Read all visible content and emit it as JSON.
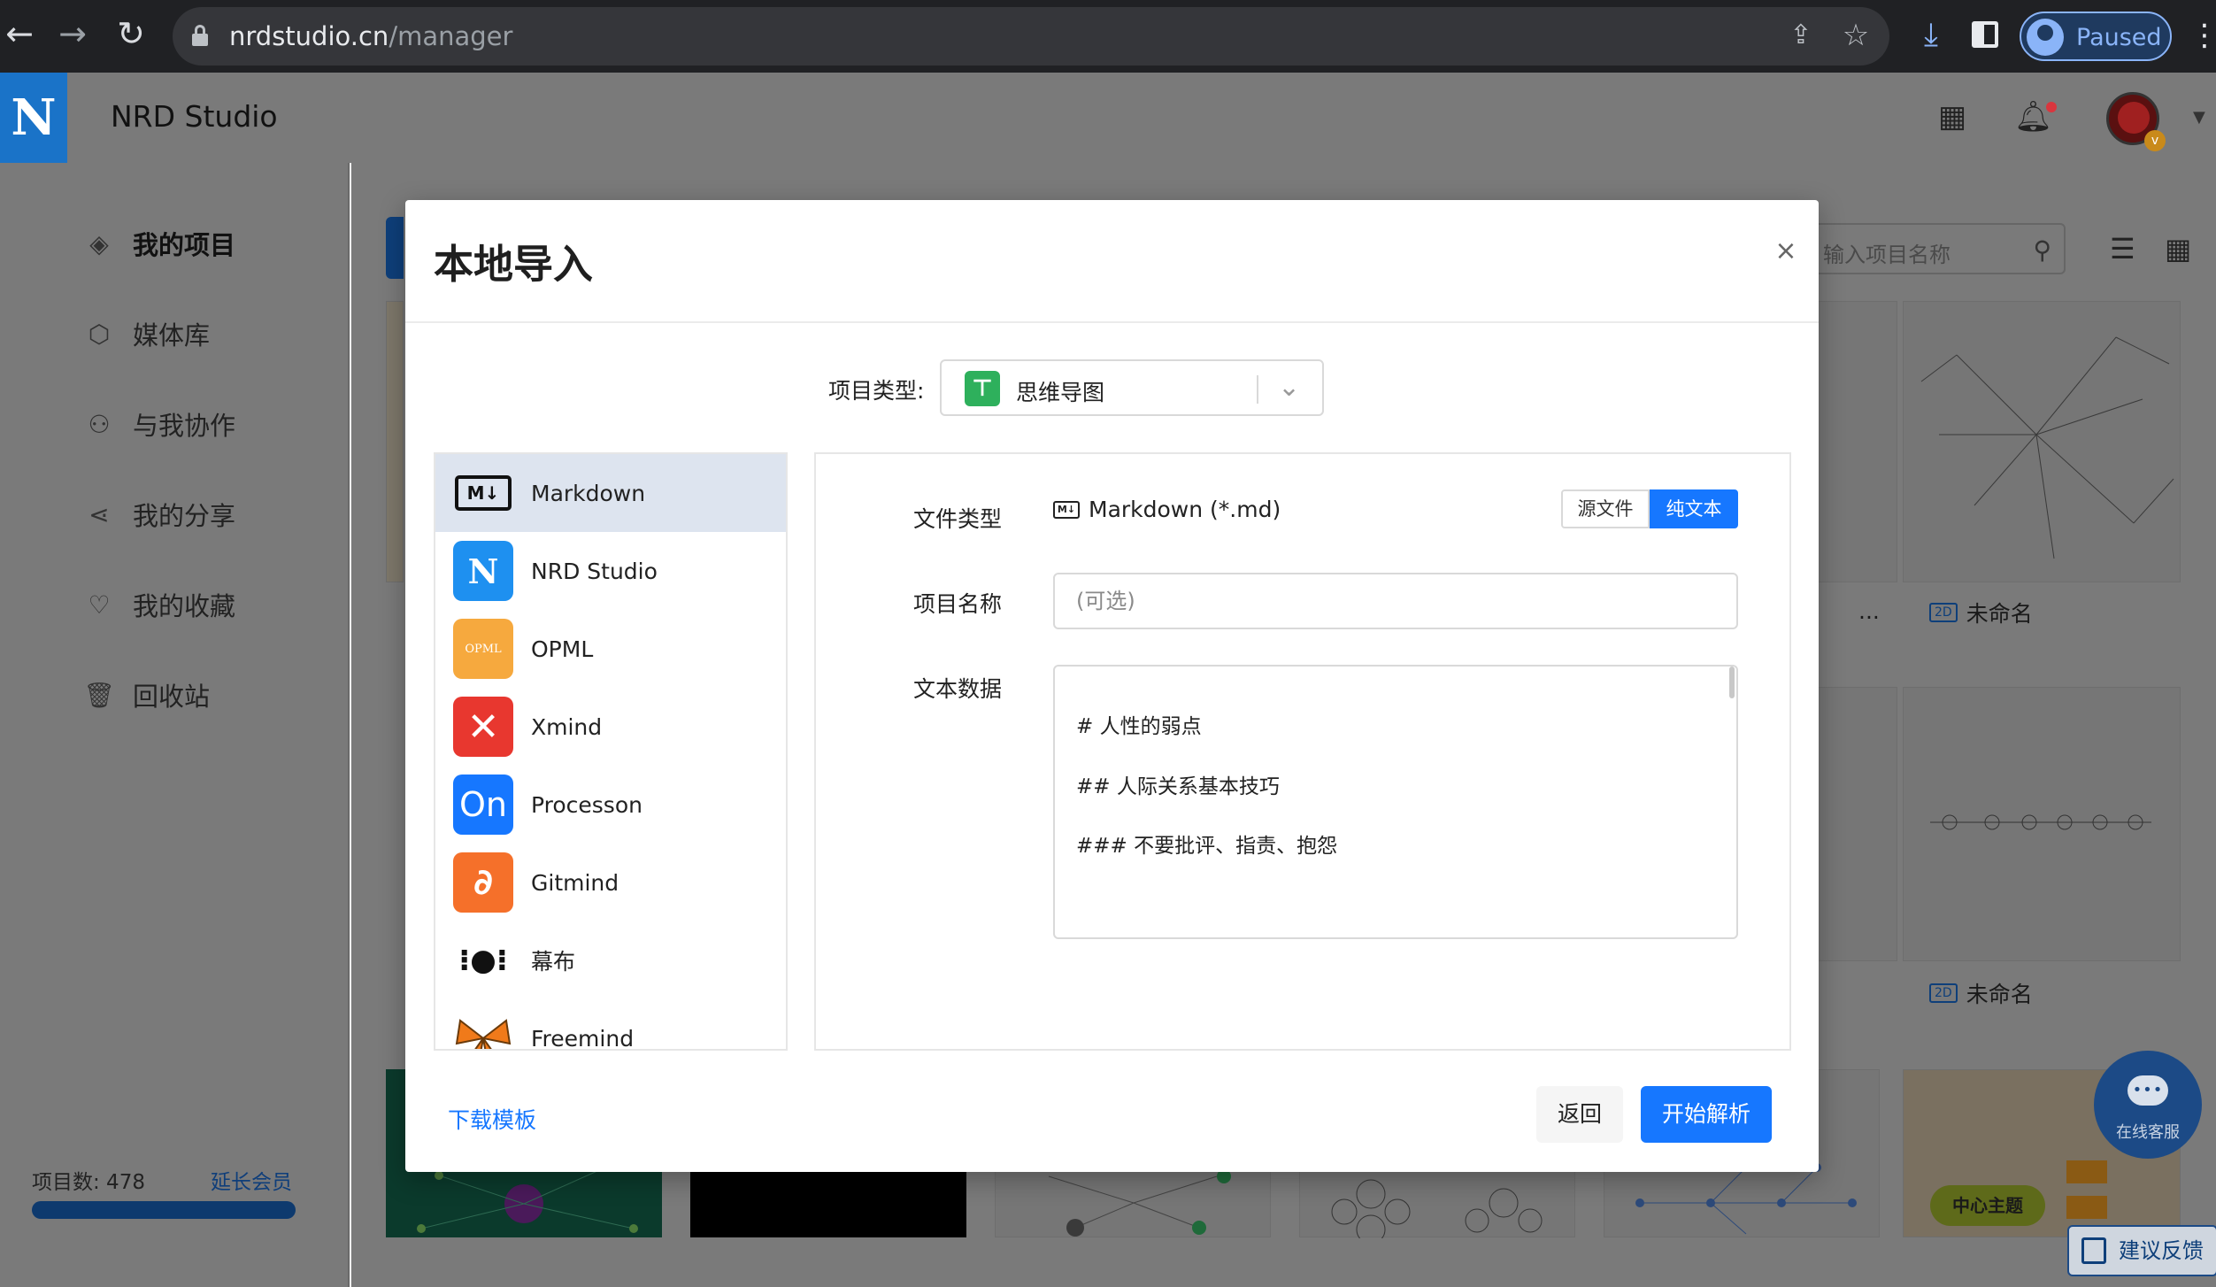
{
  "browser": {
    "url_host": "nrdstudio.cn",
    "url_path": "/manager",
    "profile_status": "Paused"
  },
  "header": {
    "brand": "NRD Studio",
    "logo_letter": "N",
    "avatar_badge": "v"
  },
  "sidebar": {
    "items": [
      {
        "label": "我的项目",
        "icon": "layers-icon",
        "active": true
      },
      {
        "label": "媒体库",
        "icon": "box-icon"
      },
      {
        "label": "与我协作",
        "icon": "users-icon"
      },
      {
        "label": "我的分享",
        "icon": "share-icon"
      },
      {
        "label": "我的收藏",
        "icon": "heart-icon"
      },
      {
        "label": "回收站",
        "icon": "trash-icon"
      }
    ],
    "project_count": "项目数: 478",
    "renew_label": "延长会员"
  },
  "main": {
    "search_placeholder": "输入项目名称",
    "card_tag": "2D",
    "card_titles": [
      "未命名",
      "未命名"
    ],
    "card_ellipsis": "...",
    "chat_fab_label": "在线客服",
    "feedback_label": "建议反馈",
    "thumb_center_topic": "中心主题"
  },
  "modal": {
    "title": "本地导入",
    "close": "×",
    "project_type_label": "项目类型:",
    "project_type_value": "思维导图",
    "sources": [
      {
        "name": "Markdown",
        "icon": "markdown-icon",
        "active": true
      },
      {
        "name": "NRD Studio",
        "icon": "nrd-studio-icon"
      },
      {
        "name": "OPML",
        "icon": "opml-icon",
        "logo_text": "OPML"
      },
      {
        "name": "Xmind",
        "icon": "xmind-icon"
      },
      {
        "name": "Processon",
        "icon": "processon-icon",
        "logo_text": "On"
      },
      {
        "name": "Gitmind",
        "icon": "gitmind-icon"
      },
      {
        "name": "幕布",
        "icon": "mubu-icon"
      },
      {
        "name": "Freemind",
        "icon": "freemind-icon"
      }
    ],
    "file_type_label": "文件类型",
    "file_type_value": "Markdown (*.md)",
    "md_badge": "M↓",
    "mode_source": "源文件",
    "mode_plain": "纯文本",
    "project_name_label": "项目名称",
    "project_name_placeholder": "(可选)",
    "text_data_label": "文本数据",
    "text_lines": [
      "# 人性的弱点",
      "## 人际关系基本技巧",
      "### 不要批评、指责、抱怨"
    ],
    "download_template": "下载模板",
    "back": "返回",
    "start_parse": "开始解析"
  },
  "colors": {
    "primary": "#1677ff",
    "overlay_bg": "#7a7a7a",
    "active_item_bg": "#dde4ef"
  }
}
